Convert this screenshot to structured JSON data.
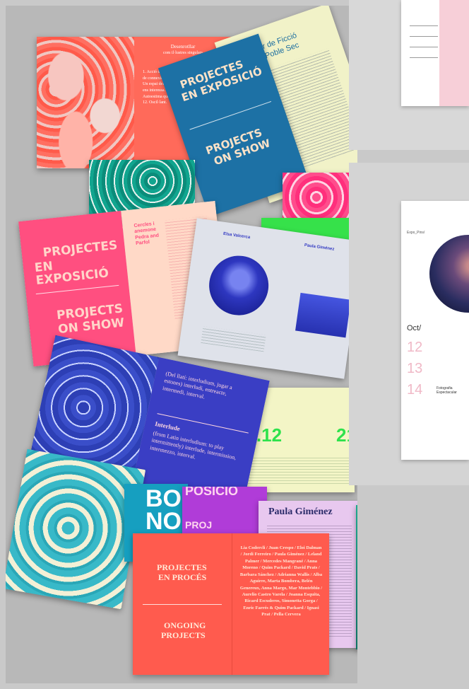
{
  "spread_pink_serif": {
    "title_line1": "Desenrotllar",
    "title_line2": "com il·lustres singulars",
    "body": "1. Acció d'aprendre. 2. Tapar amb una persona de connexions poc forts (parts, textos, etc.). 3. Un espai del dia, engranatges. 8. Il·lustrar que ens interessa. 9. En la acció. 6. Pertot. 10. Autoestima que connecta. 11. Quedar d'aquest. 12. Oscil·lant."
  },
  "cover_blue": {
    "line1": "PROJECTES",
    "line2": "EN EXPOSICIÓ",
    "line3": "PROJECTS",
    "line4": "ON SHOW"
  },
  "spread_yellow": {
    "heading_line1": "Taller de Ficció",
    "heading_line2": "del Poble Sec"
  },
  "cover_pink": {
    "line1": "PROJECTES",
    "line2": "EN EXPOSICIÓ",
    "line3": "PROJECTS",
    "line4": "ON SHOW",
    "side_heading": "Cercles i anemone Pedra and Parfol"
  },
  "spread_grey": {
    "name_left": "Elsa Valcerca",
    "name_right": "Paula Giménez"
  },
  "spread_blue": {
    "top_text": "(Del llatí: interludium, jugar a estones) interludi, entreacte, intermedi, interval.",
    "heading": "Interlude",
    "bottom_text": "(from Latin interludium: to play intermittently) interlude, intermission, intermezzo, interval."
  },
  "spread_date": {
    "date_left": "06.12",
    "date_right": "21"
  },
  "bottom_strip": {
    "big_left": "BO",
    "big_left2": "NO",
    "purple_text": "POSICIÓ",
    "purple_bottom": "PROJ"
  },
  "cover_red": {
    "line1": "PROJECTES",
    "line2": "EN PROCÉS",
    "line3": "ONGOING",
    "line4": "PROJECTS",
    "names": "Lia Codercli / Juan Crespo / Eloi Dalman / Jordi Ferreiro / Paula Giménez / Leland Palmer / Mercedes Mangrané / Anna Moreno / Quim Packard / David Prats / Barbara Sánchez / Adrianna Wallis / Alba Aguirre, Marta Bombera, Belén Genereux, Anna Margo, Mar Montebbio / Aurelio Castro Varela / Joanna Esquita, Ricard Escuderos, Simonetta Gorga / Enric Farrés & Quim Packard / Ignasi Prat / Pella Cervera"
  },
  "spread_lilac": {
    "name": "Paula Giménez"
  },
  "calendar": {
    "header": "Expo_Pins/",
    "month": "Oct/",
    "days": [
      "12",
      "13",
      "14"
    ],
    "event_text": "Fotografia Espectacular"
  },
  "colors": {
    "background": "#c9c9c9",
    "pink": "#ff5478",
    "blue": "#1e6fa0",
    "red": "#ff5a4e",
    "cobalt": "#3239c2",
    "green": "#33e34c"
  }
}
